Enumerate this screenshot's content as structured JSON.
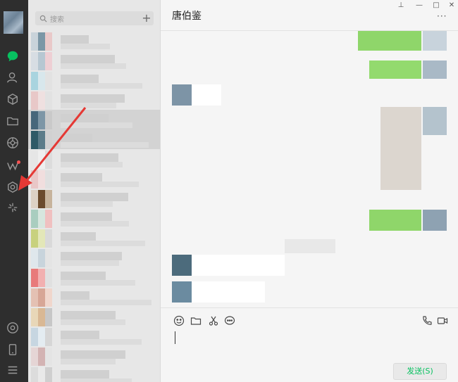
{
  "search": {
    "placeholder": "搜索",
    "add_label": "+"
  },
  "chat": {
    "title": "唐伯鉴",
    "more_label": "···"
  },
  "window": {
    "pin_label": "⊥",
    "minimize_label": "—",
    "maximize_label": "□",
    "close_label": "✕"
  },
  "composer": {
    "send_label": "发送(S)"
  },
  "nav": {
    "icons": [
      "chat-icon",
      "contacts-icon",
      "favorites-icon",
      "files-icon",
      "moments-icon",
      "channels-icon",
      "settings-icon",
      "mini-programs-icon",
      "phone-icon",
      "menu-icon"
    ],
    "has_notification_dot": true
  },
  "colors": {
    "accent": "#07c160",
    "nav_bg": "#2e2e2e",
    "list_bg": "#e7e7e7",
    "chat_bg": "#f5f5f5",
    "annotation_arrow": "#e53935"
  },
  "annotation": {
    "type": "arrow",
    "points_to": "settings-icon"
  }
}
